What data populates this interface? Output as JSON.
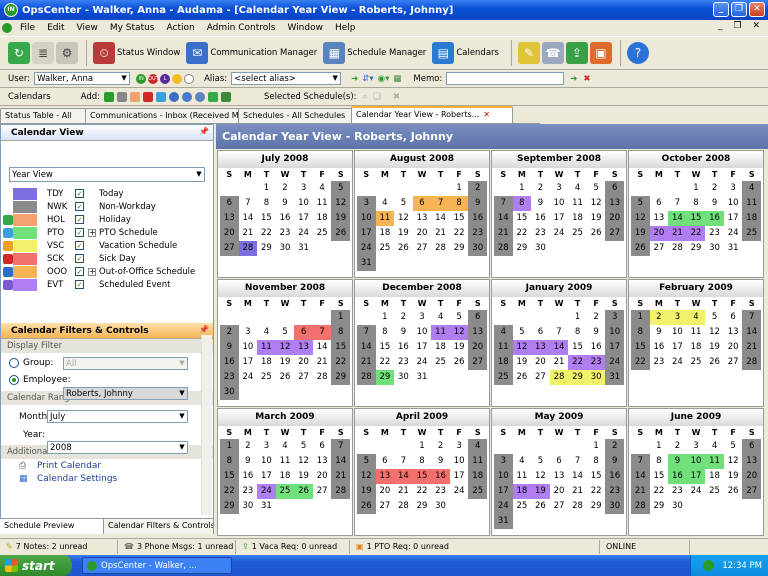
{
  "window": {
    "title": "OpsCenter - Walker, Anna - Audama - [Calendar Year View - Roberts, Johnny]",
    "app_icon": "IN"
  },
  "menu": [
    "File",
    "Edit",
    "View",
    "My Status",
    "Action",
    "Admin Controls",
    "Window",
    "Help"
  ],
  "toolbar": {
    "status_window": "Status Window",
    "comm_manager": "Communication Manager",
    "schedule_manager": "Schedule Manager",
    "calendars": "Calendars"
  },
  "usertoolbar": {
    "user_label": "User:",
    "user_value": "Walker, Anna",
    "alias_label": "Alias:",
    "alias_value": "<select alias>",
    "memo_label": "Memo:"
  },
  "caltoolbar": {
    "label": "Calendars",
    "add_label": "Add:",
    "selected_label": "Selected Schedule(s):"
  },
  "tabs": [
    {
      "label": "Status Table - All"
    },
    {
      "label": "Communications - Inbox (Received M..."
    },
    {
      "label": "Schedules - All Schedules"
    },
    {
      "label": "Calendar Year View - Roberts..."
    }
  ],
  "calendar_view": {
    "title": "Calendar View",
    "view_value": "Year View",
    "legend": [
      {
        "code": "TDY",
        "label": "Today",
        "color": "#7b6fe0"
      },
      {
        "code": "NWK",
        "label": "Non-Workday",
        "color": "#8b8b8b"
      },
      {
        "code": "HOL",
        "label": "Holiday",
        "color": "#f5a16f"
      },
      {
        "code": "PTO",
        "label": "PTO Schedule",
        "color": "#70e17a"
      },
      {
        "code": "VSC",
        "label": "Vacation Schedule",
        "color": "#f2f26a"
      },
      {
        "code": "SCK",
        "label": "Sick Day",
        "color": "#f3716c"
      },
      {
        "code": "OOO",
        "label": "Out-of-Office Schedule",
        "color": "#f6b454"
      },
      {
        "code": "EVT",
        "label": "Scheduled Event",
        "color": "#b07ef0"
      }
    ]
  },
  "filters": {
    "title": "Calendar Filters & Controls",
    "display_filter": "Display Filter",
    "group_label": "Group:",
    "group_value": "All",
    "employee_label": "Employee:",
    "employee_value": "Roberts, Johnny",
    "range_title": "Calendar Range",
    "month_label": "Month:",
    "month_value": "July",
    "year_label": "Year:",
    "year_value": "2008",
    "additional": "Additional Controls",
    "print": "Print Calendar",
    "settings": "Calendar Settings"
  },
  "bottom_tabs": [
    "Schedule Preview",
    "Calendar Filters & Controls"
  ],
  "cal_title": "Calendar Year View - Roberts, Johnny",
  "day_headers": [
    "S",
    "M",
    "T",
    "W",
    "T",
    "F",
    "S"
  ],
  "months": [
    {
      "name": "July 2008",
      "start": 2,
      "days": 31,
      "marks": {
        "28": "today"
      }
    },
    {
      "name": "August 2008",
      "start": 5,
      "days": 31,
      "marks": {
        "6": "ooo",
        "7": "ooo",
        "8": "ooo",
        "11": "ooo"
      }
    },
    {
      "name": "September 2008",
      "start": 1,
      "days": 30,
      "marks": {
        "8": "evt"
      }
    },
    {
      "name": "October 2008",
      "start": 3,
      "days": 31,
      "marks": {
        "14": "pto",
        "15": "pto",
        "16": "pto",
        "20": "evt",
        "21": "evt",
        "22": "evt"
      }
    },
    {
      "name": "November 2008",
      "start": 6,
      "days": 30,
      "marks": {
        "6": "sck",
        "7": "sck",
        "11": "evt",
        "12": "evt",
        "13": "evt"
      }
    },
    {
      "name": "December 2008",
      "start": 1,
      "days": 31,
      "marks": {
        "11": "evt",
        "12": "evt",
        "29": "pto"
      }
    },
    {
      "name": "January 2009",
      "start": 4,
      "days": 31,
      "marks": {
        "12": "evt",
        "13": "evt",
        "14": "evt",
        "22": "evt",
        "23": "evt",
        "28": "vsc",
        "29": "vsc",
        "30": "vsc"
      }
    },
    {
      "name": "February 2009",
      "start": 0,
      "days": 28,
      "marks": {
        "2": "vsc",
        "3": "vsc",
        "4": "vsc"
      }
    },
    {
      "name": "March 2009",
      "start": 0,
      "days": 31,
      "marks": {
        "24": "evt",
        "25": "pto",
        "26": "pto"
      }
    },
    {
      "name": "April 2009",
      "start": 3,
      "days": 30,
      "marks": {
        "13": "sck",
        "14": "sck",
        "15": "sck",
        "16": "sck"
      }
    },
    {
      "name": "May 2009",
      "start": 5,
      "days": 31,
      "marks": {
        "18": "evt",
        "19": "evt"
      }
    },
    {
      "name": "June 2009",
      "start": 1,
      "days": 30,
      "marks": {
        "9": "pto",
        "10": "pto",
        "11": "pto",
        "16": "pto",
        "17": "pto"
      }
    }
  ],
  "mark_colors": {
    "today": "#7b6fe0",
    "ooo": "#f6b454",
    "evt": "#b07ef0",
    "pto": "#70e17a",
    "sck": "#f3716c",
    "vsc": "#f2f26a",
    "nwk": "#8b8b8b"
  },
  "status": {
    "notes": "7 Notes: 2 unread",
    "phone": "3 Phone Msgs: 1 unread",
    "vaca": "1 Vaca Req: 0 unread",
    "pto": "1 PTO Req: 0 unread",
    "online": "ONLINE"
  },
  "taskbar": {
    "start": "start",
    "app": "OpsCenter - Walker, ...",
    "clock": "12:34 PM"
  }
}
